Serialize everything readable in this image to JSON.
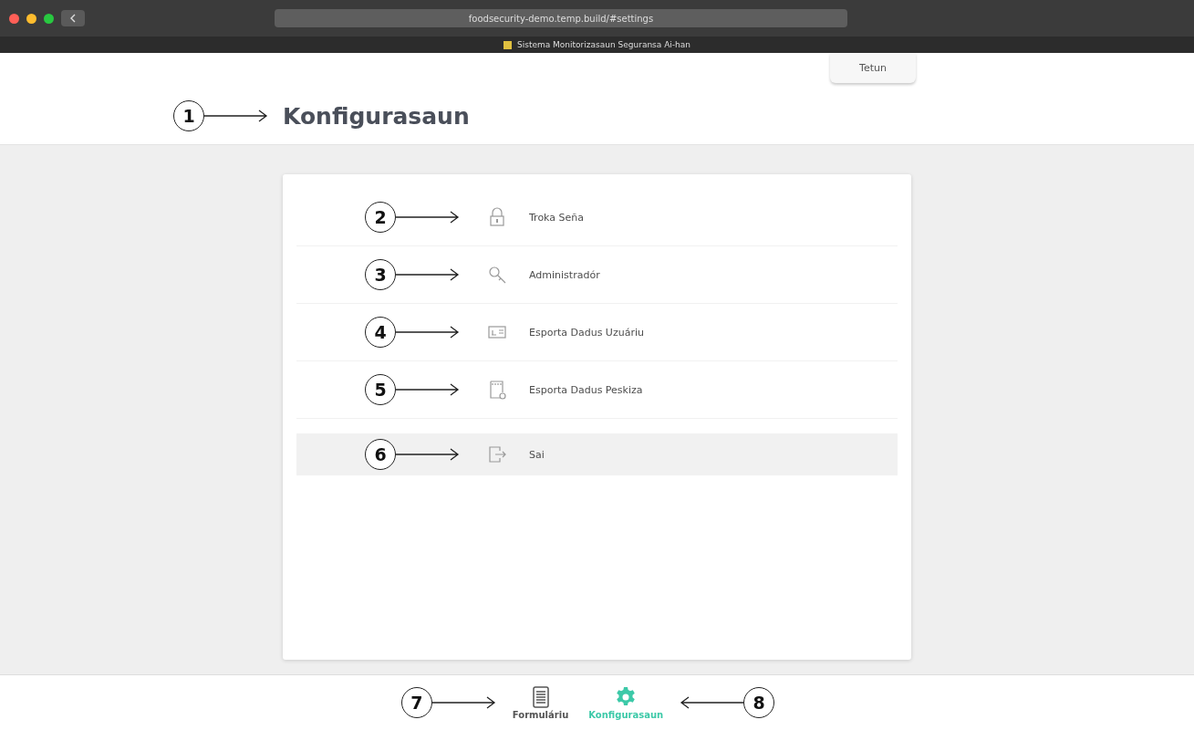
{
  "browser": {
    "url": "foodsecurity-demo.temp.build/#settings",
    "tab_title": "Sistema Monitorizasaun Seguransa Ai-han"
  },
  "language_button": "Tetun",
  "header": {
    "title": "Konfigurasaun",
    "callout": "1"
  },
  "menu": [
    {
      "kind": "lock",
      "label": "Troka Seña",
      "callout": "2",
      "selected": false
    },
    {
      "kind": "key",
      "label": "Administradór",
      "callout": "3",
      "selected": false
    },
    {
      "kind": "card",
      "label": "Esporta Dadus Uzuáriu",
      "callout": "4",
      "selected": false
    },
    {
      "kind": "doc",
      "label": "Esporta Dadus Peskiza",
      "callout": "5",
      "selected": false
    },
    {
      "kind": "logout",
      "label": "Sai",
      "callout": "6",
      "selected": true
    }
  ],
  "bottom_nav": [
    {
      "kind": "form",
      "label": "Formuláriu",
      "callout": "7",
      "selected": false
    },
    {
      "kind": "gear",
      "label": "Konfigurasaun",
      "callout": "8",
      "selected": true
    }
  ]
}
